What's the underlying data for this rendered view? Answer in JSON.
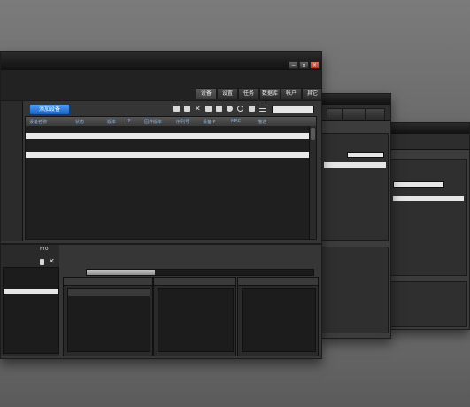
{
  "window3": {
    "rows": [
      "",
      "",
      "",
      "",
      ""
    ]
  },
  "window2": {
    "tabs": [
      "",
      "",
      ""
    ],
    "list_items": [
      "",
      "",
      "",
      "",
      ""
    ],
    "bottom_rows": [
      "",
      "",
      "",
      "",
      ""
    ]
  },
  "main": {
    "title": "",
    "tabs": [
      "设备",
      "设置",
      "任务",
      "数据库",
      "帐户",
      "其它"
    ],
    "add_device_label": "添加设备",
    "columns": [
      "设备名称",
      "状态",
      "版本",
      "IP",
      "固件版本",
      "序列号",
      "设备IP",
      "MAC",
      "描述"
    ],
    "rows": [
      {
        "cells": [
          "",
          "",
          "",
          "",
          "",
          "",
          "",
          "",
          ""
        ],
        "selected": false
      },
      {
        "cells": [
          "",
          "",
          "",
          "",
          "",
          "",
          "",
          "",
          ""
        ],
        "selected": true
      },
      {
        "cells": [
          "",
          "",
          "",
          "",
          "",
          "",
          "",
          "",
          ""
        ],
        "selected": false
      },
      {
        "cells": [
          "",
          "",
          "",
          "",
          "",
          "",
          "",
          "",
          ""
        ],
        "selected": false
      },
      {
        "cells": [
          "",
          "",
          "",
          "",
          "",
          "",
          "",
          "",
          ""
        ],
        "selected": true
      },
      {
        "cells": [
          "",
          "",
          "",
          "",
          "",
          "",
          "",
          "",
          ""
        ],
        "selected": false
      }
    ],
    "bottom": {
      "left_tabs": [
        "",
        "",
        "Pro"
      ],
      "left_header": "",
      "left_items": [
        "",
        "",
        ""
      ],
      "status_line": "",
      "progress_label": "",
      "progress_percent": 30,
      "panel1_title": "",
      "panel1_columns": [
        "",
        ""
      ],
      "panel2_title": "",
      "panel2_rows": [
        ""
      ],
      "panel3_title": "",
      "panel3_rows": [
        "",
        "",
        "",
        "",
        "",
        ""
      ]
    }
  }
}
